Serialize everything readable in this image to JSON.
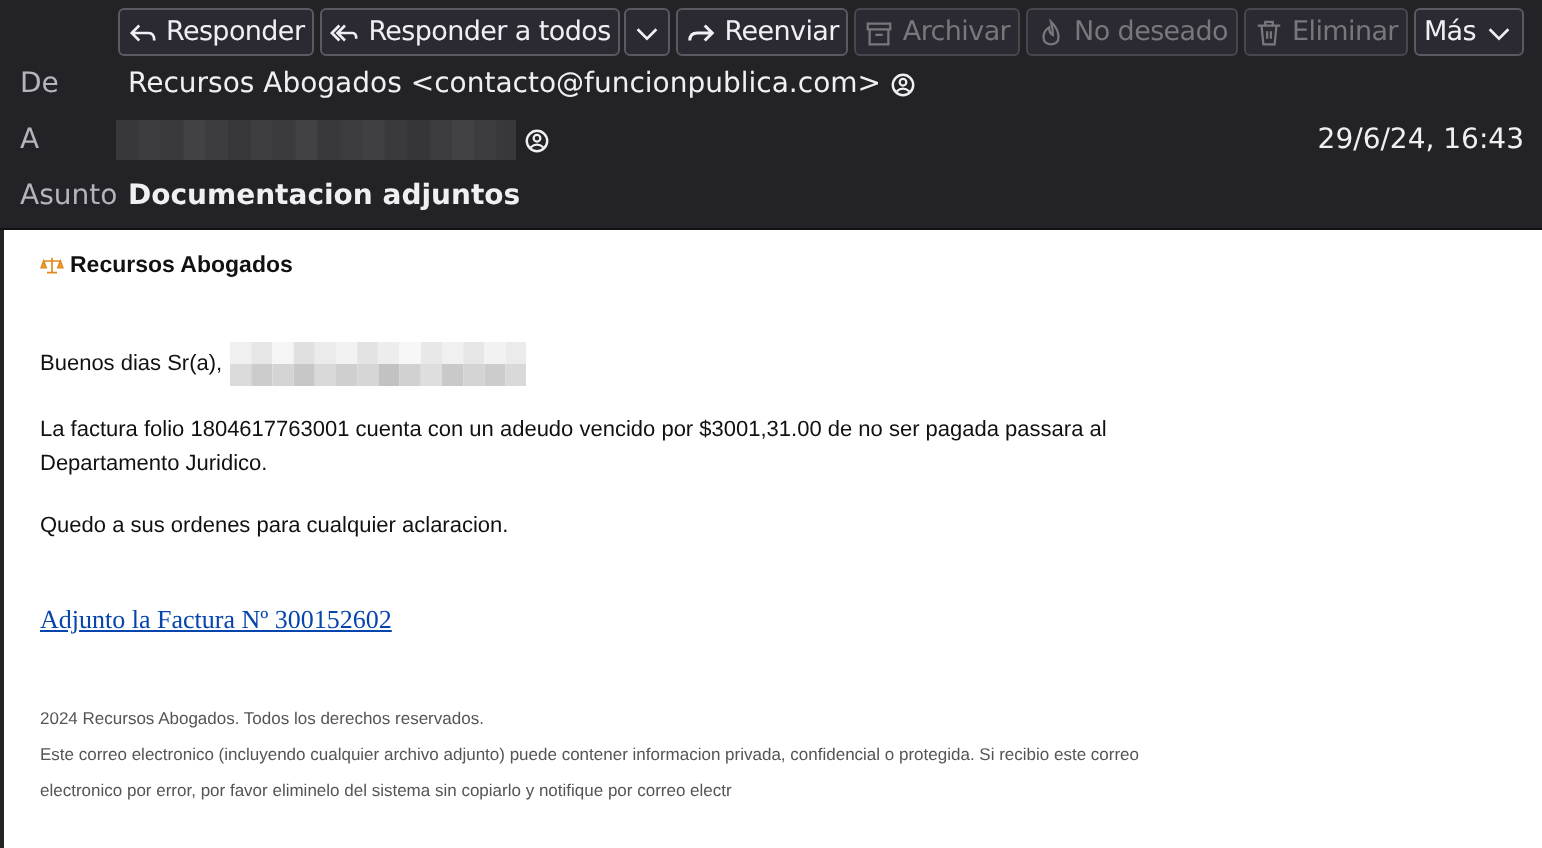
{
  "toolbar": [
    {
      "kind": "reply",
      "label": "Responder",
      "disabled": false
    },
    {
      "kind": "reply-all",
      "label": "Responder a todos",
      "disabled": false
    },
    {
      "kind": "forward",
      "label": "Reenviar",
      "disabled": false
    },
    {
      "kind": "archive",
      "label": "Archivar",
      "disabled": true
    },
    {
      "kind": "junk",
      "label": "No deseado",
      "disabled": true
    },
    {
      "kind": "delete",
      "label": "Eliminar",
      "disabled": true
    },
    {
      "kind": "more",
      "label": "Más",
      "disabled": false
    }
  ],
  "header": {
    "from_label": "De",
    "from": "Recursos Abogados <contacto@funcionpublica.com>",
    "to_label": "A",
    "date": "29/6/24, 16:43",
    "subject_label": "Asunto",
    "subject": "Documentacion adjuntos"
  },
  "body": {
    "brand": "Recursos Abogados",
    "greeting": "Buenos dias Sr(a),",
    "paragraphs": [
      "La factura folio 1804617763001 cuenta con un adeudo vencido por $3001,31.00 de no ser pagada passara al Departamento Juridico.",
      "Quedo a sus ordenes para cualquier aclaracion."
    ],
    "link": "Adjunto la Factura Nº 300152602",
    "footer": [
      "2024 Recursos Abogados. Todos los derechos reservados.",
      "Este correo electronico (incluyendo cualquier archivo adjunto) puede contener informacion privada, confidencial o protegida. Si recibio este correo electronico por error, por favor eliminelo del sistema sin copiarlo y notifique por correo electr"
    ]
  }
}
